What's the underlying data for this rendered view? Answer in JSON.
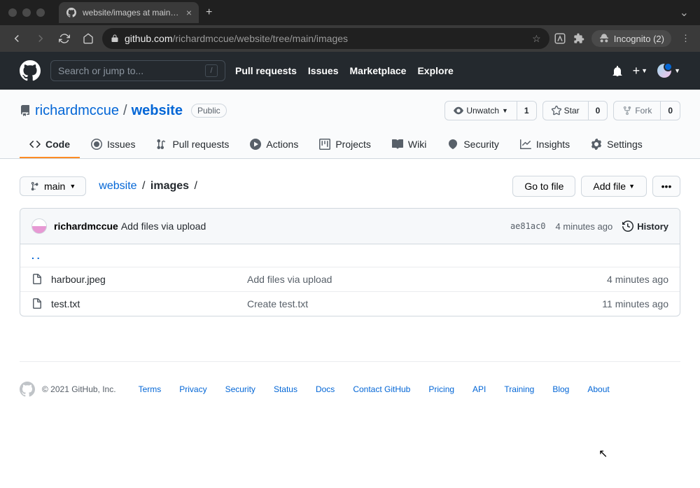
{
  "browser": {
    "tab_title": "website/images at main · richar…",
    "url_host": "github.com",
    "url_path": "/richardmccue/website/tree/main/images",
    "incognito_label": "Incognito (2)"
  },
  "header": {
    "search_placeholder": "Search or jump to...",
    "nav": [
      "Pull requests",
      "Issues",
      "Marketplace",
      "Explore"
    ]
  },
  "repo": {
    "owner": "richardmccue",
    "name": "website",
    "visibility": "Public",
    "watch_label": "Unwatch",
    "watch_count": "1",
    "star_label": "Star",
    "star_count": "0",
    "fork_label": "Fork",
    "fork_count": "0",
    "tabs": [
      {
        "label": "Code",
        "active": true
      },
      {
        "label": "Issues"
      },
      {
        "label": "Pull requests"
      },
      {
        "label": "Actions"
      },
      {
        "label": "Projects"
      },
      {
        "label": "Wiki"
      },
      {
        "label": "Security"
      },
      {
        "label": "Insights"
      },
      {
        "label": "Settings"
      }
    ]
  },
  "path": {
    "branch": "main",
    "crumbs": [
      "website",
      "images"
    ],
    "goto_file": "Go to file",
    "add_file": "Add file"
  },
  "commit": {
    "author": "richardmccue",
    "message": "Add files via upload",
    "sha": "ae81ac0",
    "time": "4 minutes ago",
    "history_label": "History"
  },
  "files": [
    {
      "name": "harbour.jpeg",
      "msg": "Add files via upload",
      "time": "4 minutes ago"
    },
    {
      "name": "test.txt",
      "msg": "Create test.txt",
      "time": "11 minutes ago"
    }
  ],
  "footer": {
    "copyright": "© 2021 GitHub, Inc.",
    "links": [
      "Terms",
      "Privacy",
      "Security",
      "Status",
      "Docs",
      "Contact GitHub",
      "Pricing",
      "API",
      "Training",
      "Blog",
      "About"
    ]
  }
}
